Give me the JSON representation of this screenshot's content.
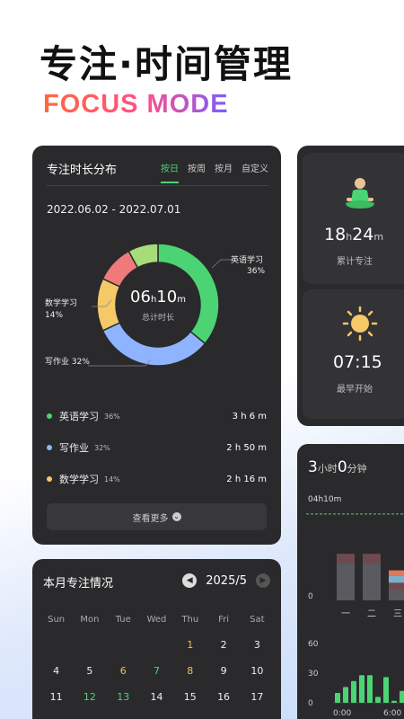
{
  "hero": {
    "title": "专注·时间管理",
    "subtitle": "FOCUS MODE"
  },
  "distribution": {
    "title": "专注时长分布",
    "tabs": [
      "按日",
      "按周",
      "按月",
      "自定义"
    ],
    "date_range": "2022.06.02 - 2022.07.01",
    "center_value_h": "06",
    "center_unit_h": "h",
    "center_value_m": "10",
    "center_unit_m": "m",
    "center_label": "总计时长",
    "callout_english": "英语学习",
    "callout_english_pct": "36%",
    "callout_math": "数学学习",
    "callout_math_pct": "14%",
    "callout_homework": "写作业 32%",
    "legend": [
      {
        "name": "英语学习",
        "pct": "36%",
        "duration": "3 h 6 m",
        "color": "#4cd474"
      },
      {
        "name": "写作业",
        "pct": "32%",
        "duration": "2 h 50 m",
        "color": "#8fb4ff"
      },
      {
        "name": "数学学习",
        "pct": "14%",
        "duration": "2 h 16 m",
        "color": "#f5c868"
      }
    ],
    "see_more": "查看更多"
  },
  "chart_data": [
    {
      "type": "pie",
      "title": "专注时长分布",
      "slices": [
        {
          "label": "英语学习",
          "value": 36,
          "color": "#4cd474"
        },
        {
          "label": "写作业",
          "value": 32,
          "color": "#8fb4ff"
        },
        {
          "label": "数学学习",
          "value": 14,
          "color": "#f5c868"
        },
        {
          "label": "",
          "value": 10,
          "color": "#f07a7a"
        },
        {
          "label": "",
          "value": 8,
          "color": "#a6dd79"
        }
      ]
    },
    {
      "type": "bar",
      "categories": [
        "一",
        "二",
        "三"
      ],
      "series": [
        {
          "values": [
            1.8,
            1.8,
            0.5
          ],
          "color": "#5a5a60"
        },
        {
          "values": [
            0.45,
            0.45,
            0.35
          ],
          "color": "#6e4a4e"
        },
        {
          "values": [
            0,
            0,
            0.35
          ],
          "color": "#7ab0c8"
        },
        {
          "values": [
            0,
            0,
            0.25
          ],
          "color": "#e0775f"
        }
      ],
      "target_label": "04h10m",
      "target_value": 4.17,
      "ylim": [
        0,
        4.6
      ],
      "ytick": "0"
    },
    {
      "type": "bar",
      "yticks": [
        "60",
        "30",
        "0"
      ],
      "xticks": [
        "0:00",
        "6:00"
      ],
      "values": [
        10,
        16,
        22,
        28,
        28,
        6,
        26,
        2,
        12,
        6,
        28
      ],
      "ylim": [
        0,
        60
      ]
    }
  ],
  "month": {
    "title": "本月专注情况",
    "label": "2025/5",
    "weekdays": [
      "Sun",
      "Mon",
      "Tue",
      "Wed",
      "Thu",
      "Fri",
      "Sat"
    ],
    "days": [
      "",
      "",
      "",
      "",
      "1",
      "2",
      "3",
      "4",
      "5",
      "6",
      "7",
      "8",
      "9",
      "10",
      "11",
      "12",
      "13",
      "14",
      "15",
      "16",
      "17"
    ],
    "day_colors": {
      "1": "y",
      "6": "y",
      "7": "g",
      "8": "y",
      "12": "g",
      "13": "g"
    }
  },
  "total": {
    "h": "18",
    "h_unit": "h",
    "m": "24",
    "m_unit": "m",
    "label": "累计专注"
  },
  "earliest": {
    "value": "07:15",
    "label": "最早开始"
  },
  "bars": {
    "hours": "3",
    "hours_unit": "小时",
    "minutes": "0",
    "minutes_unit": "分钟"
  }
}
